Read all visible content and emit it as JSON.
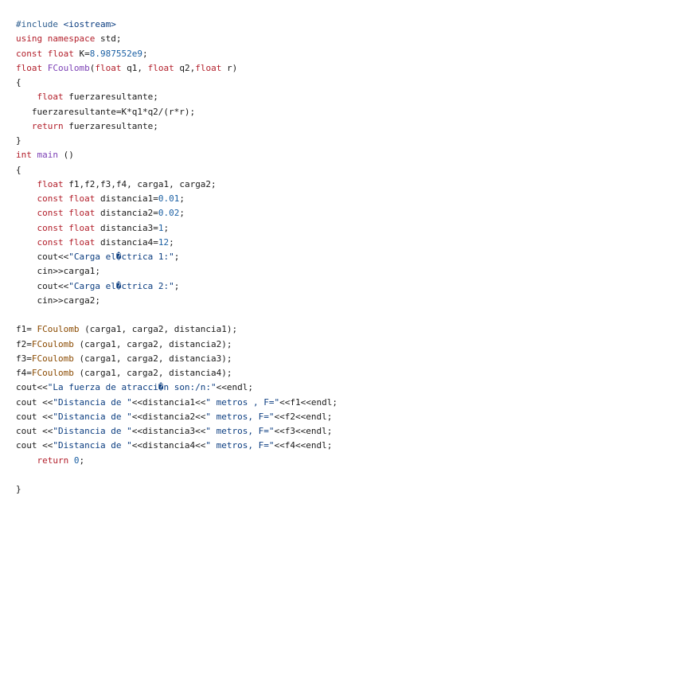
{
  "editor": {
    "lines": [
      [
        {
          "t": "pp",
          "v": "#include"
        },
        {
          "t": "tx",
          "v": " "
        },
        {
          "t": "str",
          "v": "<iostream>"
        }
      ],
      [
        {
          "t": "kw",
          "v": "using"
        },
        {
          "t": "tx",
          "v": " "
        },
        {
          "t": "kw",
          "v": "namespace"
        },
        {
          "t": "tx",
          "v": " std;"
        }
      ],
      [
        {
          "t": "kw",
          "v": "const"
        },
        {
          "t": "tx",
          "v": " "
        },
        {
          "t": "kw",
          "v": "float"
        },
        {
          "t": "tx",
          "v": " K="
        },
        {
          "t": "num",
          "v": "8.987552e9"
        },
        {
          "t": "tx",
          "v": ";"
        }
      ],
      [
        {
          "t": "kw",
          "v": "float"
        },
        {
          "t": "tx",
          "v": " "
        },
        {
          "t": "fn",
          "v": "FCoulomb"
        },
        {
          "t": "tx",
          "v": "("
        },
        {
          "t": "kw",
          "v": "float"
        },
        {
          "t": "tx",
          "v": " q1, "
        },
        {
          "t": "kw",
          "v": "float"
        },
        {
          "t": "tx",
          "v": " q2,"
        },
        {
          "t": "kw",
          "v": "float"
        },
        {
          "t": "tx",
          "v": " r)"
        }
      ],
      [
        {
          "t": "tx",
          "v": "{"
        }
      ],
      [
        {
          "t": "tx",
          "v": "    "
        },
        {
          "t": "kw",
          "v": "float"
        },
        {
          "t": "tx",
          "v": " fuerzaresultante;"
        }
      ],
      [
        {
          "t": "tx",
          "v": "   fuerzaresultante=K*q1*q2/(r*r);"
        }
      ],
      [
        {
          "t": "tx",
          "v": "   "
        },
        {
          "t": "kw",
          "v": "return"
        },
        {
          "t": "tx",
          "v": " fuerzaresultante;"
        }
      ],
      [
        {
          "t": "tx",
          "v": "}"
        }
      ],
      [
        {
          "t": "kw",
          "v": "int"
        },
        {
          "t": "tx",
          "v": " "
        },
        {
          "t": "fn",
          "v": "main"
        },
        {
          "t": "tx",
          "v": " ()"
        }
      ],
      [
        {
          "t": "tx",
          "v": "{"
        }
      ],
      [
        {
          "t": "tx",
          "v": "    "
        },
        {
          "t": "kw",
          "v": "float"
        },
        {
          "t": "tx",
          "v": " f1,f2,f3,f4, carga1, carga2;"
        }
      ],
      [
        {
          "t": "tx",
          "v": "    "
        },
        {
          "t": "kw",
          "v": "const"
        },
        {
          "t": "tx",
          "v": " "
        },
        {
          "t": "kw",
          "v": "float"
        },
        {
          "t": "tx",
          "v": " distancia1="
        },
        {
          "t": "num",
          "v": "0.01"
        },
        {
          "t": "tx",
          "v": ";"
        }
      ],
      [
        {
          "t": "tx",
          "v": "    "
        },
        {
          "t": "kw",
          "v": "const"
        },
        {
          "t": "tx",
          "v": " "
        },
        {
          "t": "kw",
          "v": "float"
        },
        {
          "t": "tx",
          "v": " distancia2="
        },
        {
          "t": "num",
          "v": "0.02"
        },
        {
          "t": "tx",
          "v": ";"
        }
      ],
      [
        {
          "t": "tx",
          "v": "    "
        },
        {
          "t": "kw",
          "v": "const"
        },
        {
          "t": "tx",
          "v": " "
        },
        {
          "t": "kw",
          "v": "float"
        },
        {
          "t": "tx",
          "v": " distancia3="
        },
        {
          "t": "num",
          "v": "1"
        },
        {
          "t": "tx",
          "v": ";"
        }
      ],
      [
        {
          "t": "tx",
          "v": "    "
        },
        {
          "t": "kw",
          "v": "const"
        },
        {
          "t": "tx",
          "v": " "
        },
        {
          "t": "kw",
          "v": "float"
        },
        {
          "t": "tx",
          "v": " distancia4="
        },
        {
          "t": "num",
          "v": "12"
        },
        {
          "t": "tx",
          "v": ";"
        }
      ],
      [
        {
          "t": "tx",
          "v": "    cout<<"
        },
        {
          "t": "str",
          "v": "\"Carga el�ctrica 1:\""
        },
        {
          "t": "tx",
          "v": ";"
        }
      ],
      [
        {
          "t": "tx",
          "v": "    cin>>carga1;"
        }
      ],
      [
        {
          "t": "tx",
          "v": "    cout<<"
        },
        {
          "t": "str",
          "v": "\"Carga el�ctrica 2:\""
        },
        {
          "t": "tx",
          "v": ";"
        }
      ],
      [
        {
          "t": "tx",
          "v": "    cin>>carga2;"
        }
      ],
      [],
      [
        {
          "t": "tx",
          "v": "f1= "
        },
        {
          "t": "call",
          "v": "FCoulomb"
        },
        {
          "t": "tx",
          "v": " (carga1, carga2, distancia1);"
        }
      ],
      [
        {
          "t": "tx",
          "v": "f2="
        },
        {
          "t": "call",
          "v": "FCoulomb"
        },
        {
          "t": "tx",
          "v": " (carga1, carga2, distancia2);"
        }
      ],
      [
        {
          "t": "tx",
          "v": "f3="
        },
        {
          "t": "call",
          "v": "FCoulomb"
        },
        {
          "t": "tx",
          "v": " (carga1, carga2, distancia3);"
        }
      ],
      [
        {
          "t": "tx",
          "v": "f4="
        },
        {
          "t": "call",
          "v": "FCoulomb"
        },
        {
          "t": "tx",
          "v": " (carga1, carga2, distancia4);"
        }
      ],
      [
        {
          "t": "tx",
          "v": "cout<<"
        },
        {
          "t": "str",
          "v": "\"La fuerza de atracci�n son:/n:\""
        },
        {
          "t": "tx",
          "v": "<<endl;"
        }
      ],
      [
        {
          "t": "tx",
          "v": "cout <<"
        },
        {
          "t": "str",
          "v": "\"Distancia de \""
        },
        {
          "t": "tx",
          "v": "<<distancia1<<"
        },
        {
          "t": "str",
          "v": "\" metros , F=\""
        },
        {
          "t": "tx",
          "v": "<<f1<<endl;"
        }
      ],
      [
        {
          "t": "tx",
          "v": "cout <<"
        },
        {
          "t": "str",
          "v": "\"Distancia de \""
        },
        {
          "t": "tx",
          "v": "<<distancia2<<"
        },
        {
          "t": "str",
          "v": "\" metros, F=\""
        },
        {
          "t": "tx",
          "v": "<<f2<<endl;"
        }
      ],
      [
        {
          "t": "tx",
          "v": "cout <<"
        },
        {
          "t": "str",
          "v": "\"Distancia de \""
        },
        {
          "t": "tx",
          "v": "<<distancia3<<"
        },
        {
          "t": "str",
          "v": "\" metros, F=\""
        },
        {
          "t": "tx",
          "v": "<<f3<<endl;"
        }
      ],
      [
        {
          "t": "tx",
          "v": "cout <<"
        },
        {
          "t": "str",
          "v": "\"Distancia de \""
        },
        {
          "t": "tx",
          "v": "<<distancia4<<"
        },
        {
          "t": "str",
          "v": "\" metros, F=\""
        },
        {
          "t": "tx",
          "v": "<<f4<<endl;"
        }
      ],
      [
        {
          "t": "tx",
          "v": "    "
        },
        {
          "t": "kw",
          "v": "return"
        },
        {
          "t": "tx",
          "v": " "
        },
        {
          "t": "num",
          "v": "0"
        },
        {
          "t": "tx",
          "v": ";"
        }
      ],
      [],
      [
        {
          "t": "tx",
          "v": "}"
        }
      ]
    ]
  }
}
